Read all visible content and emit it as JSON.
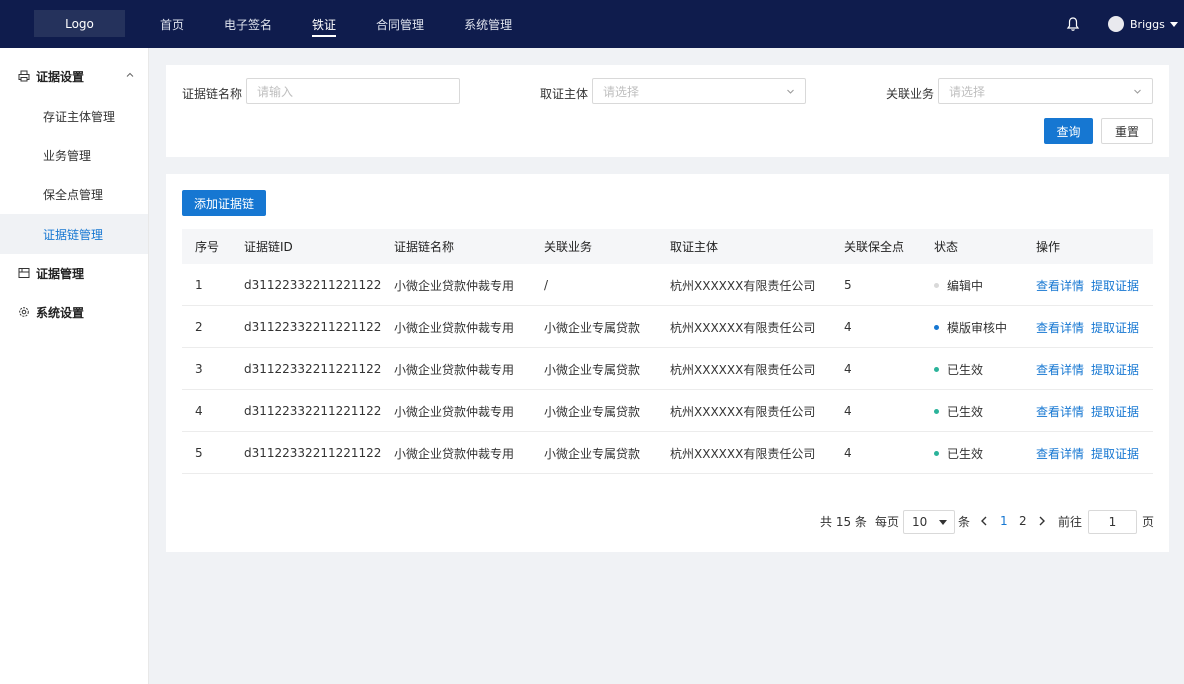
{
  "topbar": {
    "logo": "Logo",
    "nav": [
      "首页",
      "电子签名",
      "铁证",
      "合同管理",
      "系统管理"
    ],
    "active_nav": "铁证",
    "user_name": "Briggs"
  },
  "sidebar": {
    "groups": [
      {
        "label": "证据设置",
        "icon": "printer-icon",
        "expanded": true,
        "items": [
          "存证主体管理",
          "业务管理",
          "保全点管理",
          "证据链管理"
        ]
      },
      {
        "label": "证据管理",
        "icon": "folder-icon"
      },
      {
        "label": "系统设置",
        "icon": "gear-icon"
      }
    ],
    "active_item": "证据链管理"
  },
  "search": {
    "name_label": "证据链名称",
    "name_placeholder": "请输入",
    "subject_label": "取证主体",
    "subject_placeholder": "请选择",
    "business_label": "关联业务",
    "business_placeholder": "请选择",
    "query_btn": "查询",
    "reset_btn": "重置"
  },
  "table": {
    "add_btn": "添加证据链",
    "columns": [
      "序号",
      "证据链ID",
      "证据链名称",
      "关联业务",
      "取证主体",
      "关联保全点",
      "状态",
      "操作"
    ],
    "rows": [
      {
        "no": "1",
        "id": "d31122332211221122",
        "name": "小微企业贷款仲裁专用",
        "business": "/",
        "subject": "杭州XXXXXX有限责任公司",
        "points": "5",
        "status": "编辑中",
        "status_color": "#d9d9d9"
      },
      {
        "no": "2",
        "id": "d31122332211221122",
        "name": "小微企业贷款仲裁专用",
        "business": "小微企业专属贷款",
        "subject": "杭州XXXXXX有限责任公司",
        "points": "4",
        "status": "模版审核中",
        "status_color": "#1677d2"
      },
      {
        "no": "3",
        "id": "d31122332211221122",
        "name": "小微企业贷款仲裁专用",
        "business": "小微企业专属贷款",
        "subject": "杭州XXXXXX有限责任公司",
        "points": "4",
        "status": "已生效",
        "status_color": "#2bb39a"
      },
      {
        "no": "4",
        "id": "d31122332211221122",
        "name": "小微企业贷款仲裁专用",
        "business": "小微企业专属贷款",
        "subject": "杭州XXXXXX有限责任公司",
        "points": "4",
        "status": "已生效",
        "status_color": "#2bb39a"
      },
      {
        "no": "5",
        "id": "d31122332211221122",
        "name": "小微企业贷款仲裁专用",
        "business": "小微企业专属贷款",
        "subject": "杭州XXXXXX有限责任公司",
        "points": "4",
        "status": "已生效",
        "status_color": "#2bb39a"
      }
    ],
    "actions": [
      "查看详情",
      "提取证据"
    ]
  },
  "pagination": {
    "total_text": "共 15 条",
    "per_page_label": "每页",
    "per_page": "10",
    "unit": "条",
    "pages": [
      "1",
      "2"
    ],
    "current_page": "1",
    "goto_label": "前往",
    "goto_value": "1",
    "page_suffix": "页"
  }
}
